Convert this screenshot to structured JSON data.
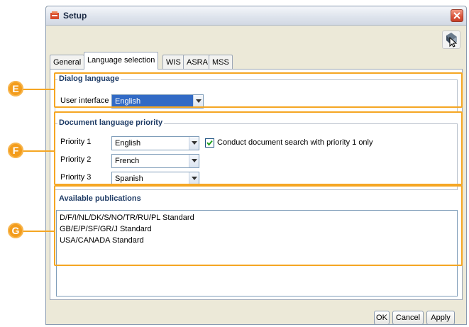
{
  "window": {
    "title": "Setup",
    "help_icon": "help-cursor-icon",
    "close_icon": "close-icon"
  },
  "tabs": [
    {
      "label": "General"
    },
    {
      "label": "Language selection",
      "active": true
    },
    {
      "label": "WIS"
    },
    {
      "label": "ASRA"
    },
    {
      "label": "MSS"
    }
  ],
  "dialog_language": {
    "title": "Dialog language",
    "ui_label": "User interface",
    "ui_value": "English"
  },
  "document_priority": {
    "title": "Document language priority",
    "rows": [
      {
        "label": "Priority 1",
        "value": "English"
      },
      {
        "label": "Priority 2",
        "value": "French"
      },
      {
        "label": "Priority 3",
        "value": "Spanish"
      }
    ],
    "checkbox_label": "Conduct document search with priority 1 only",
    "checkbox_checked": true
  },
  "publications": {
    "title": "Available publications",
    "items": [
      "D/F/I/NL/DK/S/NO/TR/RU/PL Standard",
      "GB/E/P/SF/GR/J Standard",
      "USA/CANADA Standard"
    ]
  },
  "buttons": {
    "ok": "OK",
    "cancel": "Cancel",
    "apply": "Apply"
  },
  "callouts": [
    "E",
    "F",
    "G"
  ],
  "colors": {
    "highlight": "#f5a623",
    "accent": "#316ac5",
    "group_title": "#1f3c66"
  }
}
